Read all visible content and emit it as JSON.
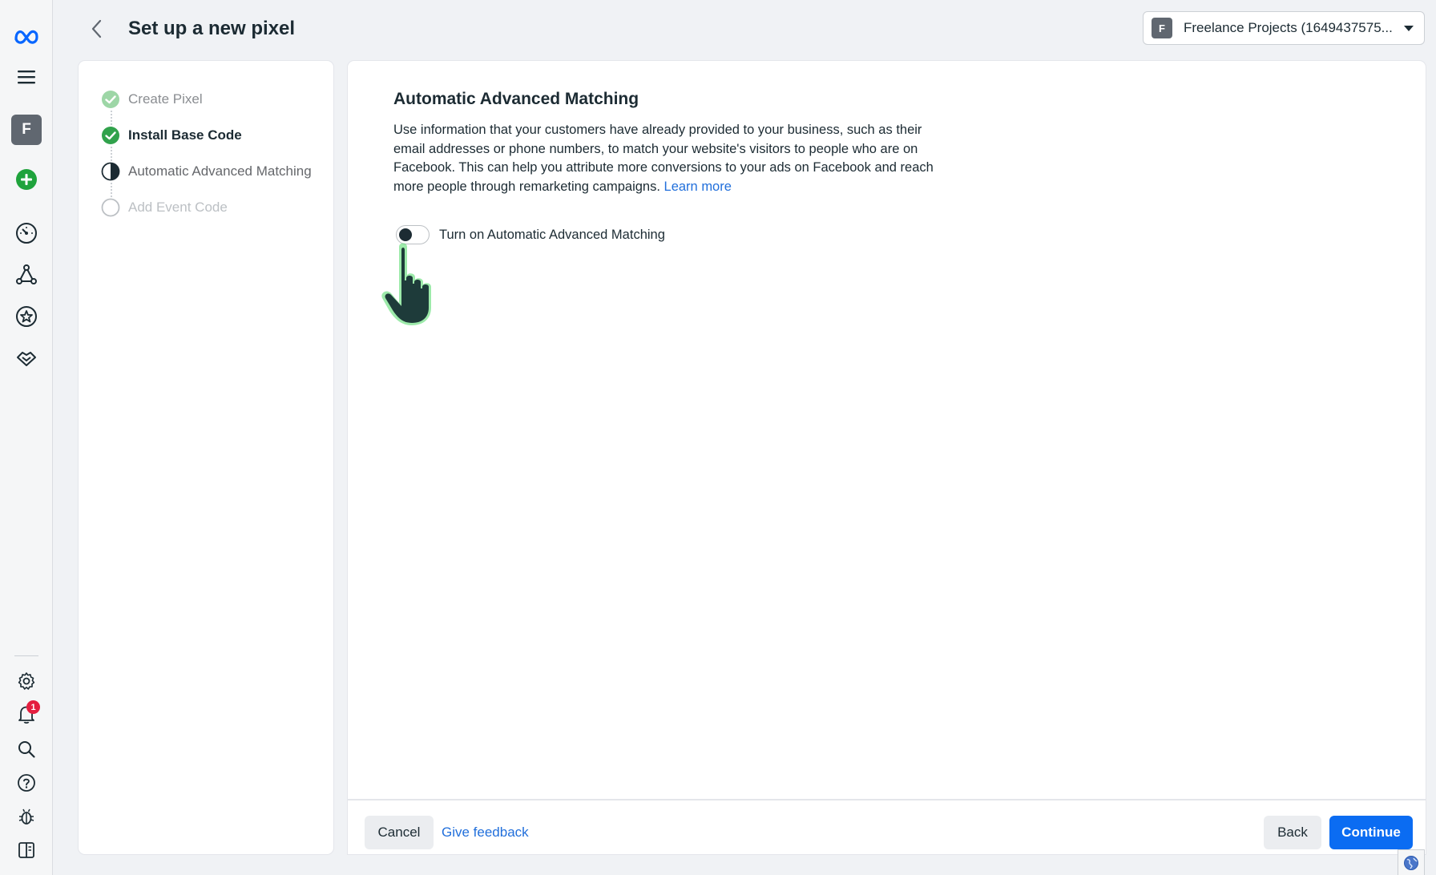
{
  "header": {
    "title": "Set up a new pixel",
    "account_initial": "F",
    "account_name": "Freelance Projects (1649437575..."
  },
  "rail": {
    "account_initial": "F",
    "notification_count": "1"
  },
  "steps": [
    {
      "label": "Create Pixel",
      "state": "done"
    },
    {
      "label": "Install Base Code",
      "state": "current-done"
    },
    {
      "label": "Automatic Advanced Matching",
      "state": "in-progress"
    },
    {
      "label": "Add Event Code",
      "state": "not-started"
    }
  ],
  "main": {
    "section_title": "Automatic Advanced Matching",
    "description": "Use information that your customers have already provided to your business, such as their email addresses or phone numbers, to match your website's visitors to people who are on Facebook. This can help you attribute more conversions to your ads on Facebook and reach more people through remarketing campaigns.",
    "learn_more": "Learn more",
    "toggle_label": "Turn on Automatic Advanced Matching",
    "toggle_on": false
  },
  "footer": {
    "cancel": "Cancel",
    "give_feedback": "Give feedback",
    "back": "Back",
    "continue": "Continue"
  },
  "colors": {
    "accent_blue": "#0b6cf2",
    "link_blue": "#216fdb",
    "success_green": "#31a24c",
    "add_green": "#1fa33c",
    "cursor_green": "#4cd964"
  },
  "icons": [
    "meta-logo-icon",
    "hamburger-menu-icon",
    "add-icon",
    "dashboard-gauge-icon",
    "graph-nodes-icon",
    "star-badge-icon",
    "handshake-icon",
    "gear-icon",
    "bell-icon",
    "search-icon",
    "help-icon",
    "bug-icon",
    "sidebar-panel-icon",
    "back-chevron-icon",
    "caret-down-icon",
    "globe-icon",
    "hand-pointer-icon"
  ]
}
